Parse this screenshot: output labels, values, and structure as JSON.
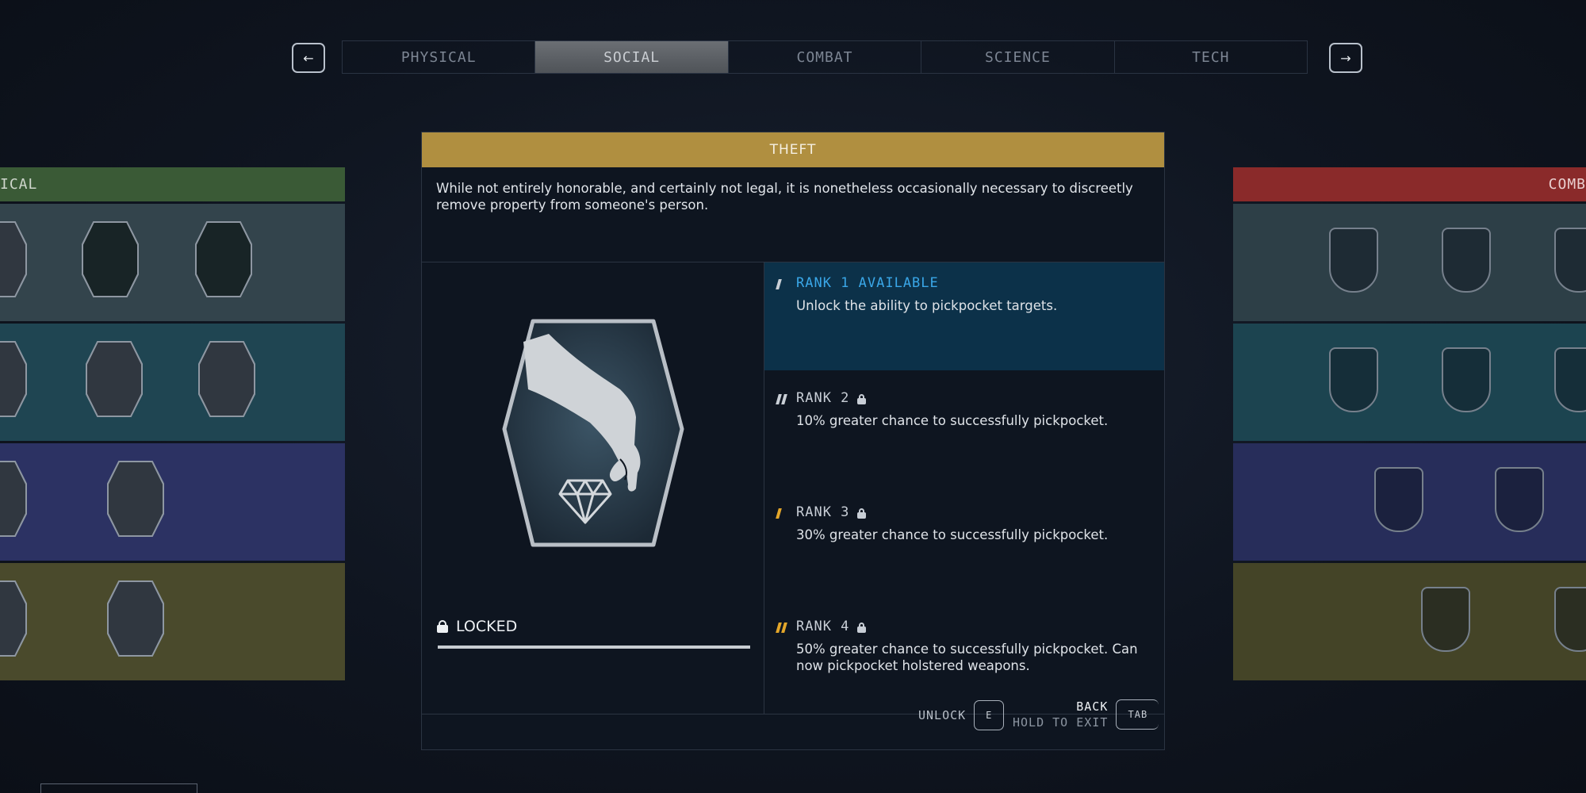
{
  "nav": {
    "prev_icon": "arrow-left",
    "next_icon": "arrow-right",
    "prev_glyph": "←",
    "next_glyph": "→",
    "tabs": [
      {
        "label": "PHYSICAL",
        "active": false
      },
      {
        "label": "SOCIAL",
        "active": true
      },
      {
        "label": "COMBAT",
        "active": false
      },
      {
        "label": "SCIENCE",
        "active": false
      },
      {
        "label": "TECH",
        "active": false
      }
    ]
  },
  "left_tree": {
    "header_fragment": "ICAL",
    "color": "#3a5a36"
  },
  "right_tree": {
    "header_fragment": "COMB",
    "color": "#8a2a2a"
  },
  "skill": {
    "title": "THEFT",
    "title_color": "#b08f40",
    "description": "While not entirely honorable, and certainly not legal, it is nonetheless occasionally necessary to discreetly remove property from someone's person.",
    "status": "LOCKED",
    "emblem_icon": "hand-dropping-diamond-icon"
  },
  "ranks": [
    {
      "label": "RANK 1 AVAILABLE",
      "locked": false,
      "description": "Unlock the ability to pickpocket targets.",
      "highlight_color": "#3aa7e8"
    },
    {
      "label": "RANK 2",
      "locked": true,
      "description": "10% greater chance to successfully pickpocket."
    },
    {
      "label": "RANK 3",
      "locked": true,
      "description": "30% greater chance to successfully pickpocket."
    },
    {
      "label": "RANK 4",
      "locked": true,
      "description": "50% greater chance to successfully pickpocket. Can now pickpocket holstered weapons."
    }
  ],
  "footer": {
    "unlock_label": "UNLOCK",
    "unlock_key": "E",
    "back_label": "BACK",
    "exit_label": "HOLD TO EXIT",
    "back_key": "TAB"
  }
}
